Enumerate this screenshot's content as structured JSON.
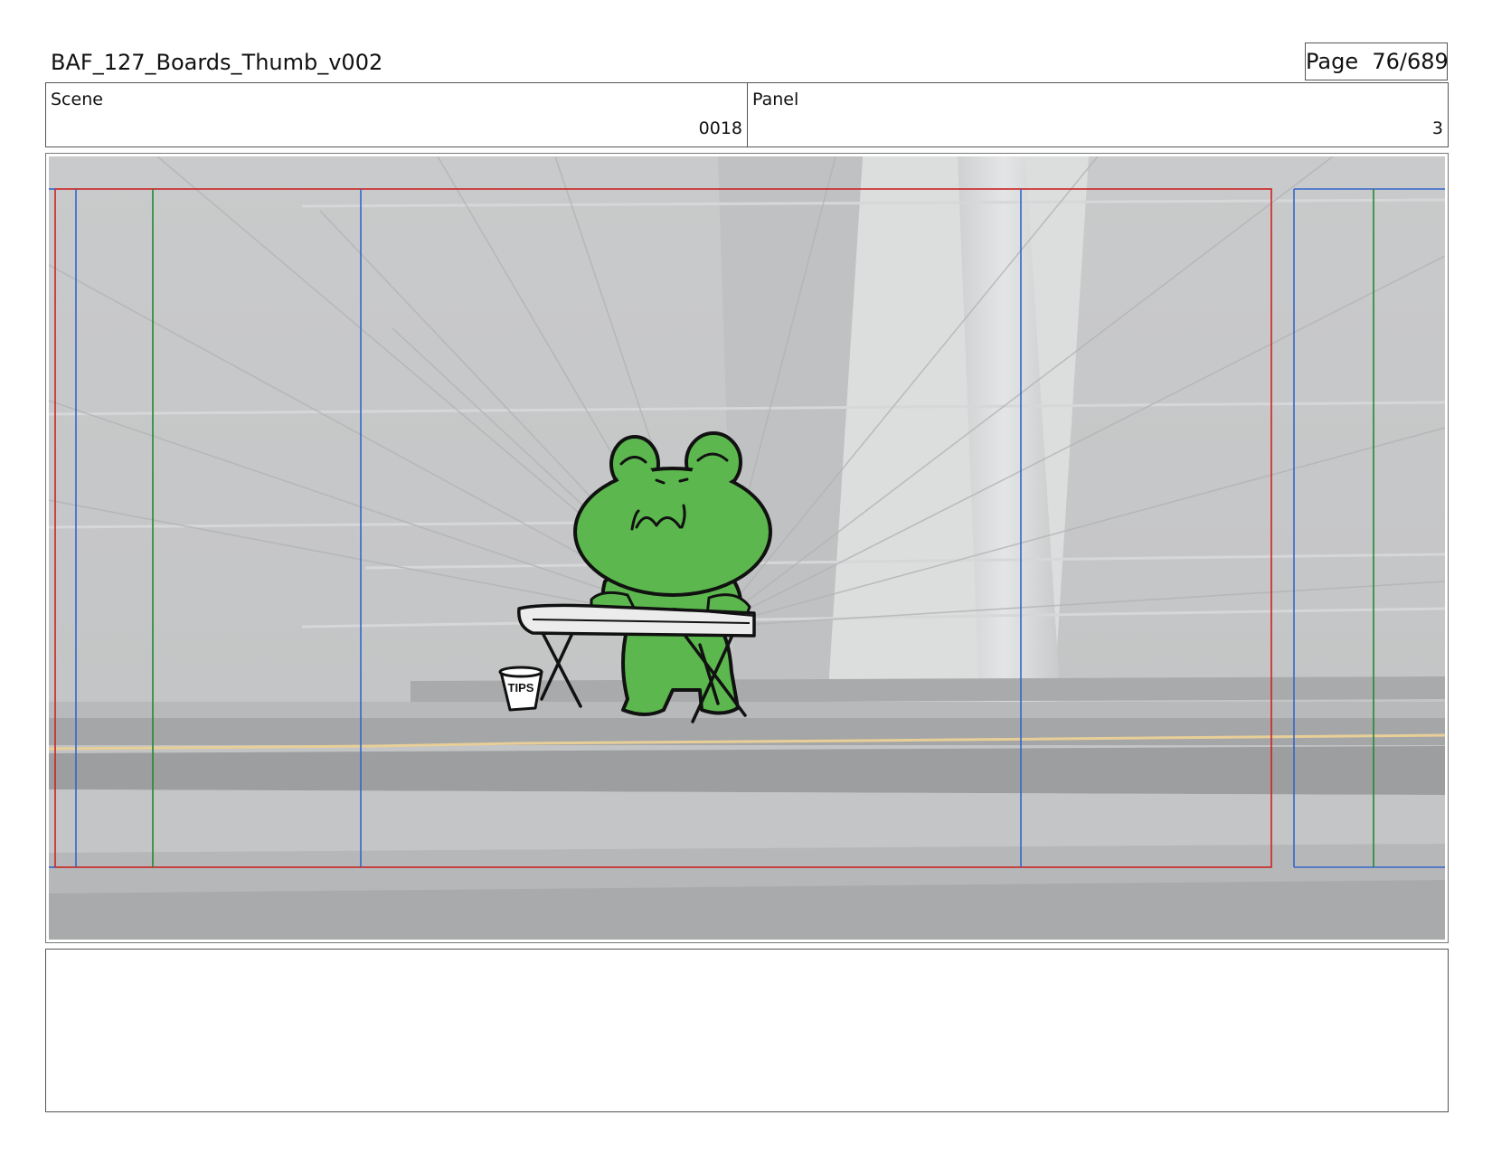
{
  "document": {
    "title": "BAF_127_Boards_Thumb_v002",
    "page_label": "Page",
    "page_number": "76/689"
  },
  "scene": {
    "label": "Scene",
    "value": "0018"
  },
  "panel": {
    "label": "Panel",
    "value": "3"
  },
  "artwork": {
    "tip_cup_text": "TIPS",
    "safe_area_colors": {
      "red": "#cc2222",
      "blue": "#3366cc",
      "green": "#228833"
    },
    "frog_color": "#5cb84e"
  },
  "notes": {
    "text": ""
  }
}
